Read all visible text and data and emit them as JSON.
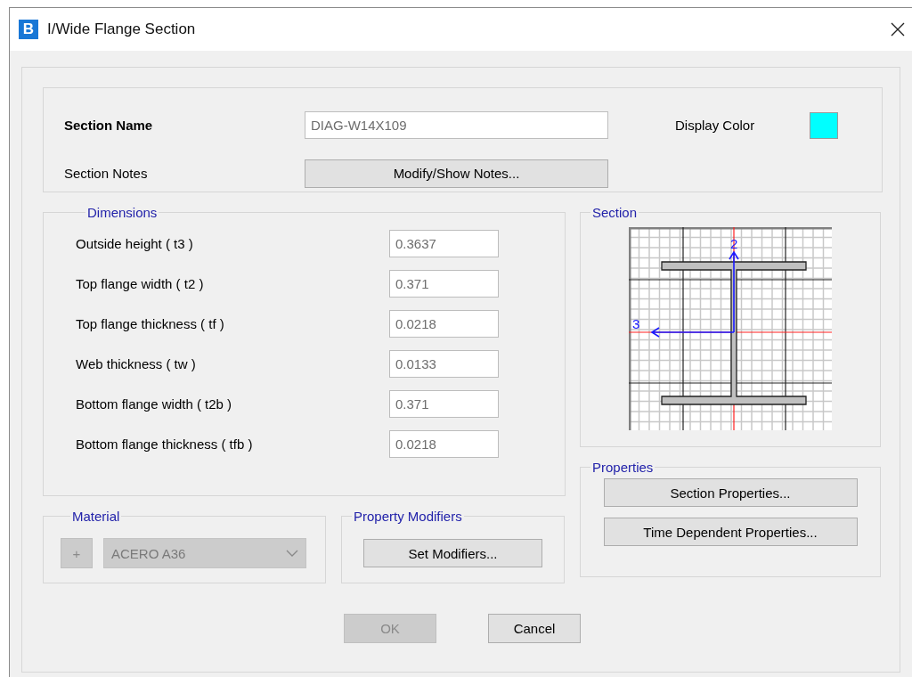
{
  "window": {
    "app_icon": "B",
    "title": "I/Wide Flange Section"
  },
  "section_name": {
    "label": "Section Name",
    "value": "DIAG-W14X109"
  },
  "display_color": {
    "label": "Display Color",
    "color": "#00ffff"
  },
  "section_notes": {
    "label": "Section Notes",
    "button": "Modify/Show Notes..."
  },
  "dimensions": {
    "title": "Dimensions",
    "fields": [
      {
        "label": "Outside height ( t3 )",
        "value": "0.3637"
      },
      {
        "label": "Top flange width ( t2 )",
        "value": "0.371"
      },
      {
        "label": "Top flange thickness ( tf )",
        "value": "0.0218"
      },
      {
        "label": "Web thickness ( tw )",
        "value": "0.0133"
      },
      {
        "label": "Bottom flange width ( t2b )",
        "value": "0.371"
      },
      {
        "label": "Bottom flange thickness ( tfb )",
        "value": "0.0218"
      }
    ]
  },
  "section": {
    "title": "Section",
    "axis_labels": [
      "2",
      "3"
    ]
  },
  "material": {
    "title": "Material",
    "add_button": "+",
    "value": "ACERO A36",
    "disabled": true
  },
  "property_modifiers": {
    "title": "Property Modifiers",
    "button": "Set Modifiers..."
  },
  "properties": {
    "title": "Properties",
    "buttons": [
      "Section Properties...",
      "Time Dependent Properties..."
    ]
  },
  "buttons": [
    {
      "label": "OK",
      "disabled": true
    },
    {
      "label": "Cancel",
      "disabled": false
    }
  ]
}
